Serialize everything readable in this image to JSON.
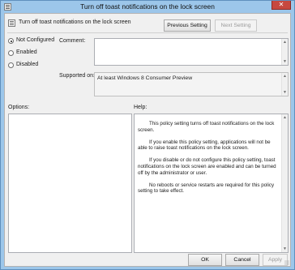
{
  "window": {
    "title": "Turn off toast notifications on the lock screen",
    "close_glyph": "✕",
    "title_icon": "policy-icon",
    "close_color": "#c7483f"
  },
  "header": {
    "policy_name": "Turn off toast notifications on the lock screen",
    "policy_icon": "policy-icon",
    "previous_label": "Previous Setting",
    "next_label": "Next Setting"
  },
  "state": {
    "options": [
      {
        "label": "Not Configured",
        "checked": true
      },
      {
        "label": "Enabled",
        "checked": false
      },
      {
        "label": "Disabled",
        "checked": false
      }
    ]
  },
  "comment": {
    "label": "Comment:",
    "value": ""
  },
  "supported": {
    "label": "Supported on:",
    "value": "At least Windows 8 Consumer Preview"
  },
  "options_panel": {
    "label": "Options:"
  },
  "help_panel": {
    "label": "Help:",
    "paragraphs": [
      "This policy setting turns off toast notifications on the lock screen.",
      "If you enable this policy setting, applications will not be able to raise toast notifications on the lock screen.",
      "If you disable or do not configure this policy setting, toast notifications on the lock screen are enabled and can be turned off by the administrator or user.",
      "No reboots or service restarts are required for this policy setting to take effect."
    ]
  },
  "footer": {
    "ok_label": "OK",
    "cancel_label": "Cancel",
    "apply_label": "Apply"
  },
  "scroll_glyphs": {
    "up": "▲",
    "down": "▼"
  }
}
